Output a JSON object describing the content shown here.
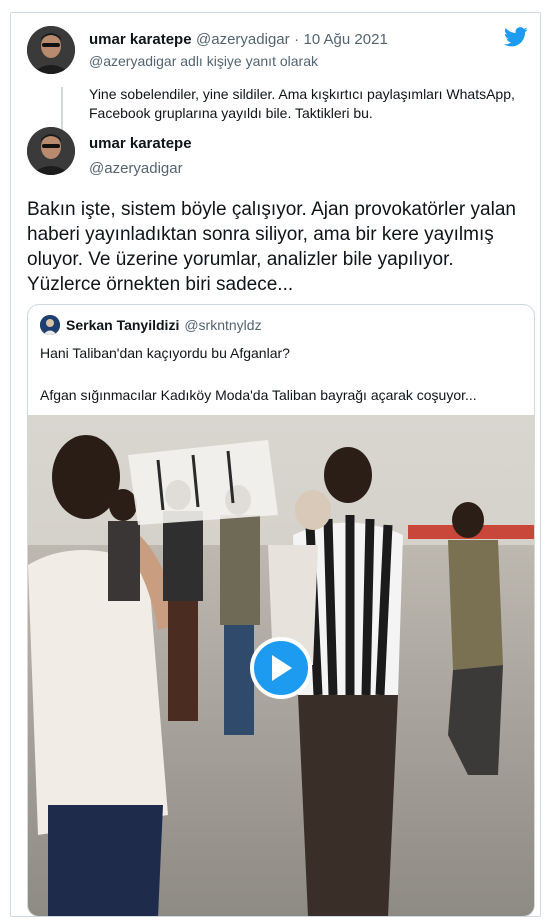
{
  "parent_tweet": {
    "author_name": "umar karatepe",
    "author_handle": "@azeryadigar",
    "separator": "·",
    "date": "10 Ağu 2021",
    "reply_context": "@azeryadigar adlı kişiye yanıt olarak",
    "text": "Yine sobelendiler, yine sildiler. Ama kışkırtıcı paylaşımları WhatsApp, Facebook gruplarına yayıldı bile. Taktikleri bu."
  },
  "main_tweet": {
    "author_name": "umar karatepe",
    "author_handle": "@azeryadigar",
    "text": "Bakın işte, sistem böyle çalışıyor. Ajan provokatörler yalan haberi yayınladıktan sonra siliyor, ama bir kere yayılmış oluyor. Ve üzerine yorumlar, analizler bile yapılıyor. Yüzlerce örnekten biri sadece..."
  },
  "quoted_tweet": {
    "author_name": "Serkan Tanyildizi",
    "author_handle": "@srkntnyldz",
    "line1": "Hani Taliban'dan kaçıyordu bu Afganlar?",
    "line2": "Afgan sığınmacılar Kadıköy Moda'da Taliban bayrağı açarak coşuyor..."
  },
  "colors": {
    "brand": "#1d9bf0",
    "muted_text": "#536471",
    "border": "#cfd9de"
  },
  "icons": {
    "logo": "twitter-bird-icon",
    "play": "play-icon"
  }
}
